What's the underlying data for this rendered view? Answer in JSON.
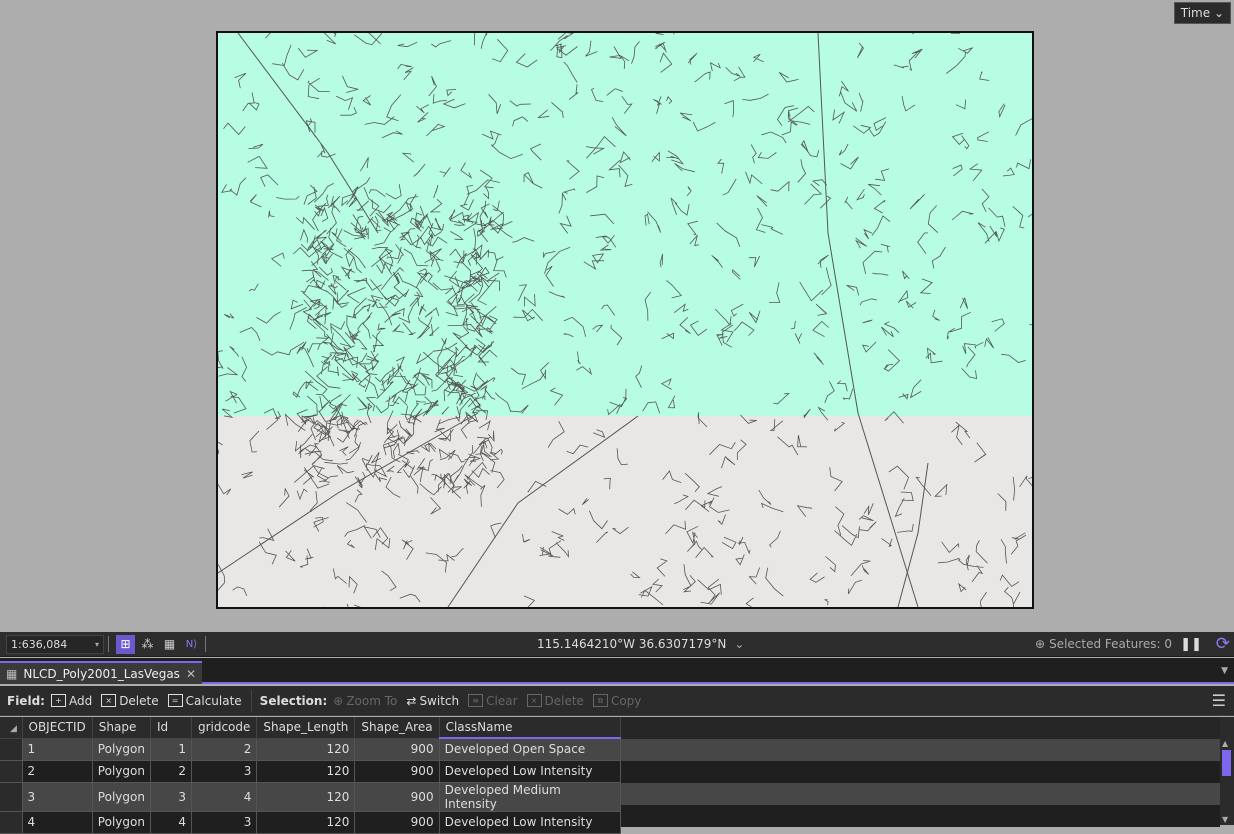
{
  "map": {
    "time_button": "Time",
    "colors": {
      "upper_fill": "#b6fde3",
      "lower_fill": "#e8e7e5",
      "outline": "#555555",
      "background": "#adadad"
    }
  },
  "statusbar": {
    "scale": "1:636,084",
    "coordinates": "115.1464210°W 36.6307179°N",
    "selected_features": "Selected Features: 0"
  },
  "tab": {
    "label": "NLCD_Poly2001_LasVegas"
  },
  "toolbar": {
    "field_label": "Field:",
    "add": "Add",
    "delete": "Delete",
    "calculate": "Calculate",
    "selection_label": "Selection:",
    "zoom_to": "Zoom To",
    "switch": "Switch",
    "clear": "Clear",
    "sel_delete": "Delete",
    "copy": "Copy"
  },
  "table": {
    "columns": [
      "OBJECTID",
      "Shape",
      "Id",
      "gridcode",
      "Shape_Length",
      "Shape_Area",
      "ClassName"
    ],
    "rows": [
      [
        "1",
        "Polygon",
        "1",
        "2",
        "120",
        "900",
        "Developed Open Space"
      ],
      [
        "2",
        "Polygon",
        "2",
        "3",
        "120",
        "900",
        "Developed Low Intensity"
      ],
      [
        "3",
        "Polygon",
        "3",
        "4",
        "120",
        "900",
        "Developed Medium Intensity"
      ],
      [
        "4",
        "Polygon",
        "4",
        "3",
        "120",
        "900",
        "Developed Low Intensity"
      ]
    ]
  },
  "accent": "#7b68ee"
}
